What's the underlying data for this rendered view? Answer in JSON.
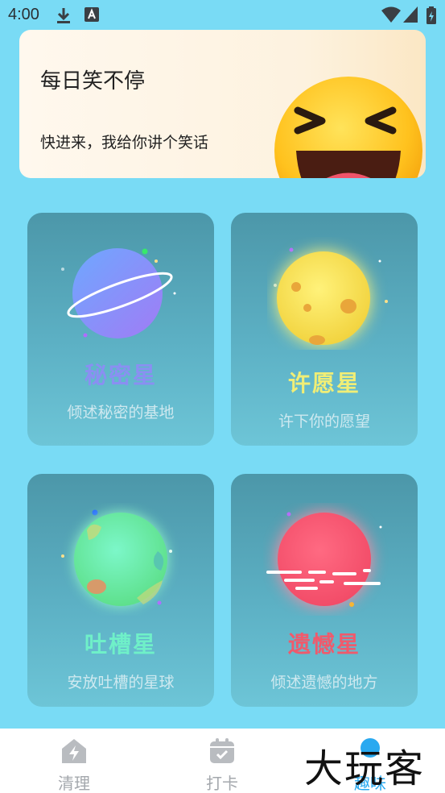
{
  "status_bar": {
    "time": "4:00"
  },
  "banner": {
    "title": "每日笑不停",
    "subtitle": "快进来，我给你讲个笑话"
  },
  "cards": [
    {
      "title": "秘密星",
      "subtitle": "倾述秘密的基地",
      "title_color": "#8a8ff2"
    },
    {
      "title": "许愿星",
      "subtitle": "许下你的愿望",
      "title_color": "#f0ee76"
    },
    {
      "title": "吐槽星",
      "subtitle": "安放吐槽的星球",
      "title_color": "#6ff0c8"
    },
    {
      "title": "遗憾星",
      "subtitle": "倾述遗憾的地方",
      "title_color": "#ef5a6c"
    }
  ],
  "bottom_nav": {
    "items": [
      {
        "label": "清理",
        "icon": "home-bolt-icon"
      },
      {
        "label": "打卡",
        "icon": "calendar-check-icon"
      },
      {
        "label": "趣味",
        "icon": "fun-icon",
        "active": true
      }
    ],
    "active_color": "#29a9f0"
  },
  "watermark": "大玩客"
}
